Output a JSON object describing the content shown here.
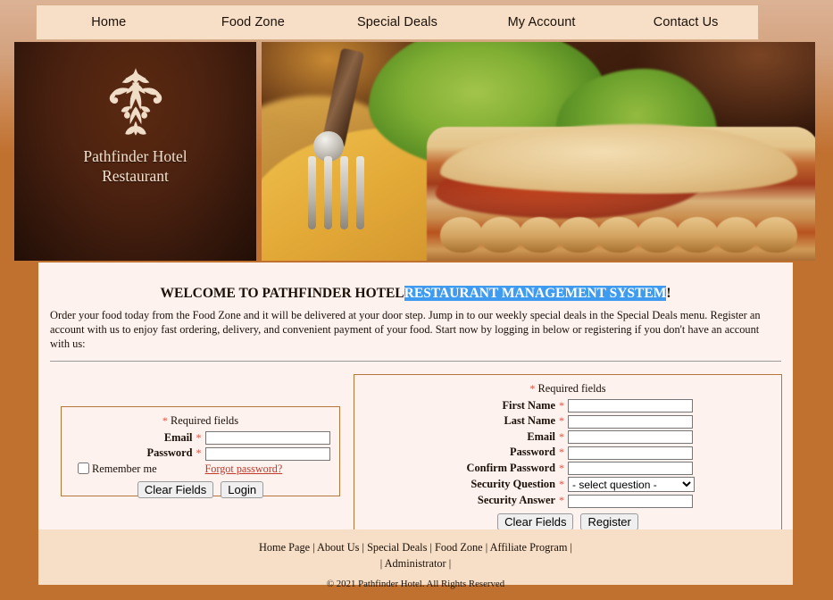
{
  "nav": {
    "items": [
      {
        "label": "Home",
        "name": "nav-home"
      },
      {
        "label": "Food Zone",
        "name": "nav-food-zone"
      },
      {
        "label": "Special Deals",
        "name": "nav-special-deals"
      },
      {
        "label": "My Account",
        "name": "nav-my-account"
      },
      {
        "label": "Contact Us",
        "name": "nav-contact-us"
      }
    ]
  },
  "brand": {
    "line1": "Pathfinder Hotel",
    "line2": "Restaurant",
    "ornament_icon": "fleur-de-lis-ornament-icon"
  },
  "hero": {
    "photo_alt": "lasagna-plate-photo"
  },
  "welcome": {
    "prefix": "WELCOME TO PATHFINDER HOTEL",
    "highlight": "RESTAURANT MANAGEMENT SYSTEM",
    "suffix": "!",
    "intro": "Order your food today from the Food Zone and it will be delivered at your door step. Jump in to our weekly special deals in the Special Deals menu. Register an account with us to enjoy fast ordering, delivery, and convenient payment of your food. Start now by logging in below or registering if you don't have an account with us:"
  },
  "login": {
    "required_note": "Required fields",
    "star": "*",
    "fields": [
      {
        "label": "Email",
        "value": "",
        "placeholder": ""
      },
      {
        "label": "Password",
        "value": "",
        "placeholder": ""
      }
    ],
    "remember_label": "Remember me",
    "remember_checked": false,
    "forgot_label": "Forgot password?",
    "clear_label": "Clear Fields",
    "submit_label": "Login"
  },
  "register": {
    "required_note": "Required fields",
    "star": "*",
    "fields": [
      {
        "label": "First Name",
        "value": "",
        "placeholder": ""
      },
      {
        "label": "Last Name",
        "value": "",
        "placeholder": ""
      },
      {
        "label": "Email",
        "value": "",
        "placeholder": ""
      },
      {
        "label": "Password",
        "value": "",
        "placeholder": ""
      },
      {
        "label": "Confirm Password",
        "value": "",
        "placeholder": ""
      }
    ],
    "security_question_label": "Security Question",
    "security_question_selected": "- select question -",
    "security_answer_label": "Security Answer",
    "security_answer_value": "",
    "clear_label": "Clear Fields",
    "submit_label": "Register"
  },
  "footer": {
    "links": [
      {
        "label": "Home Page"
      },
      {
        "label": "About Us"
      },
      {
        "label": "Special Deals"
      },
      {
        "label": "Food Zone"
      },
      {
        "label": "Affiliate Program"
      }
    ],
    "links_line2": [
      {
        "label": "Administrator"
      }
    ],
    "separator": "|",
    "copyright": "© 2021 Pathfinder Hotel. All Rights Reserved"
  },
  "colors": {
    "page_bg": "#c0702f",
    "nav_bg": "#f7dfc7",
    "content_bg": "#fdf2ee",
    "panel_border": "#b5763a",
    "logo_bg": "#4a2110",
    "highlight": "#3e9bf0",
    "required_star": "#e24b3a",
    "link_red": "#c0392b"
  }
}
